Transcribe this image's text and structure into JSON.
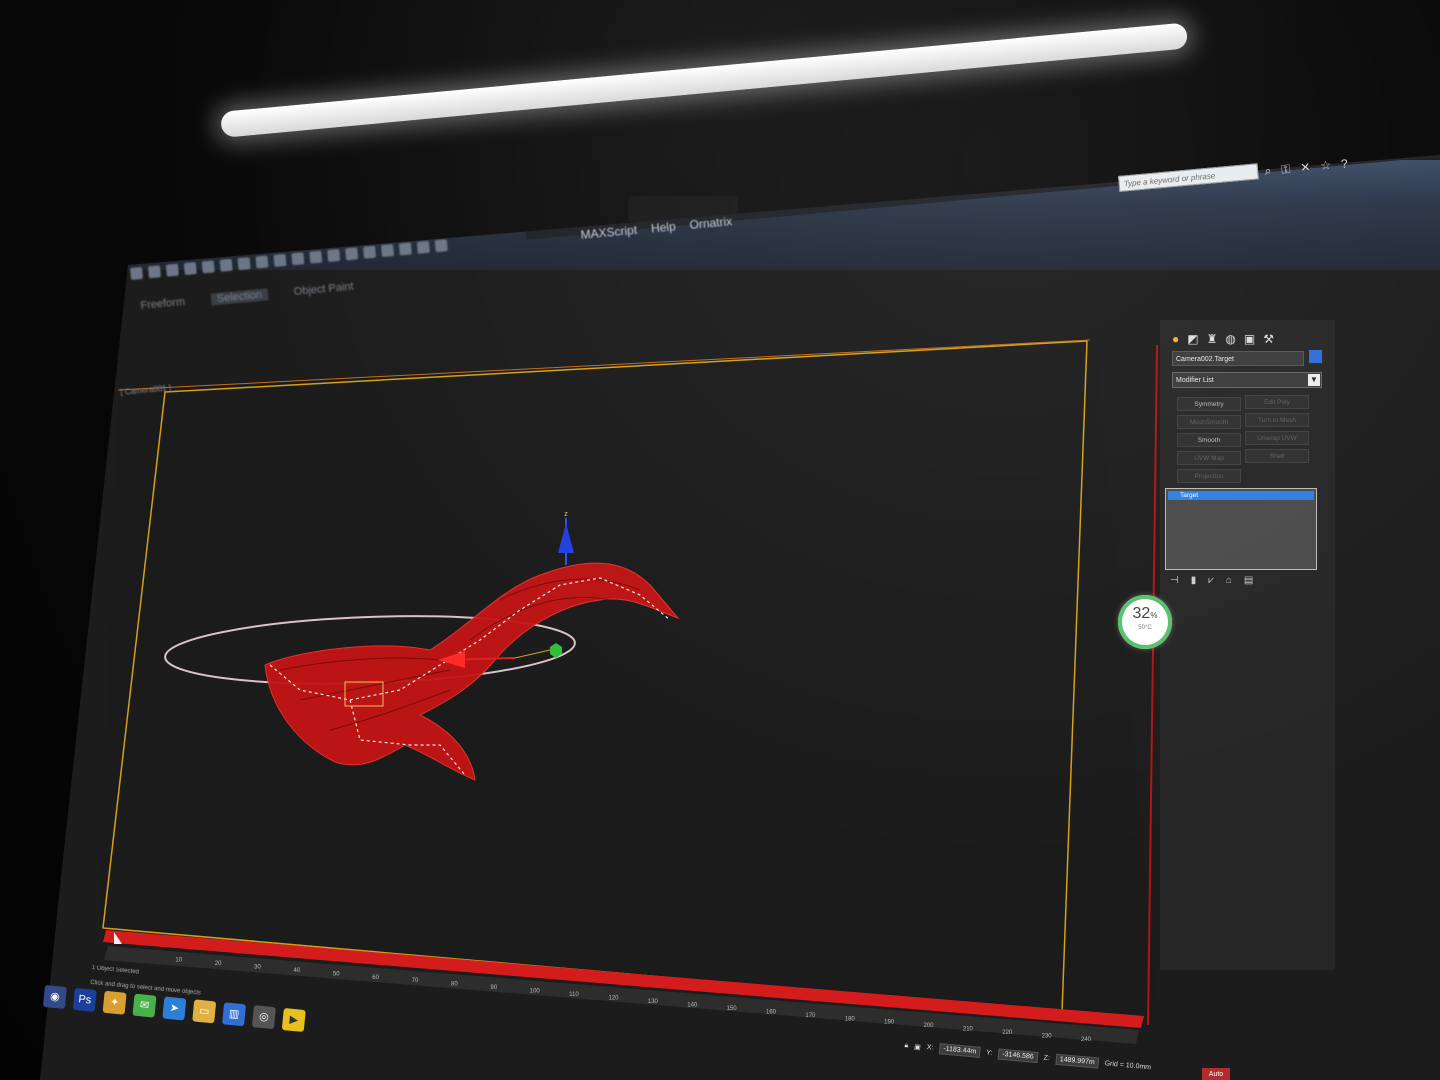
{
  "search": {
    "placeholder": "Type a keyword or phrase"
  },
  "menu": {
    "items": [
      "MAXScript",
      "Help",
      "Ornatrix"
    ]
  },
  "ribbon": {
    "tabs": [
      "Freeform",
      "Selection",
      "Object Paint"
    ]
  },
  "command_panel": {
    "object_name": "Camera002.Target",
    "modifier_list_label": "Modifier List",
    "modifier_buttons": [
      {
        "label": "Symmetry",
        "enabled": true
      },
      {
        "label": "Edit Poly",
        "enabled": false
      },
      {
        "label": "MeshSmooth",
        "enabled": false
      },
      {
        "label": "Turn to Mesh",
        "enabled": false
      },
      {
        "label": "Smooth",
        "enabled": true
      },
      {
        "label": "Unwrap UVW",
        "enabled": false
      },
      {
        "label": "UVW Map",
        "enabled": false
      },
      {
        "label": "Shell",
        "enabled": false
      },
      {
        "label": "Projection",
        "enabled": false
      }
    ],
    "stack_item": "Target"
  },
  "performance_meter": {
    "value": "32",
    "unit": "%",
    "temperature": "50°C"
  },
  "timeline": {
    "ticks": [
      "10",
      "20",
      "30",
      "40",
      "50",
      "60",
      "70",
      "80",
      "90",
      "100",
      "110",
      "120",
      "130",
      "140",
      "150",
      "160",
      "170",
      "180",
      "190",
      "200",
      "210",
      "220",
      "230",
      "240"
    ]
  },
  "status": {
    "line1": "1 Object Selected",
    "line2": "Click and drag to select and move objects"
  },
  "coordinates": {
    "x_label": "X:",
    "x": "-1183.44m",
    "y_label": "Y:",
    "y": "-3146.586",
    "z_label": "Z:",
    "z": "1489.997m",
    "grid": "Grid = 10.0mm"
  },
  "auto_key": "Auto",
  "colors": {
    "model_red": "#c41414",
    "viewport_border": "#d4a017",
    "timeline_red": "#d41c1c",
    "selection_blue": "#2f7fe0",
    "perf_ring": "#56c26a"
  }
}
